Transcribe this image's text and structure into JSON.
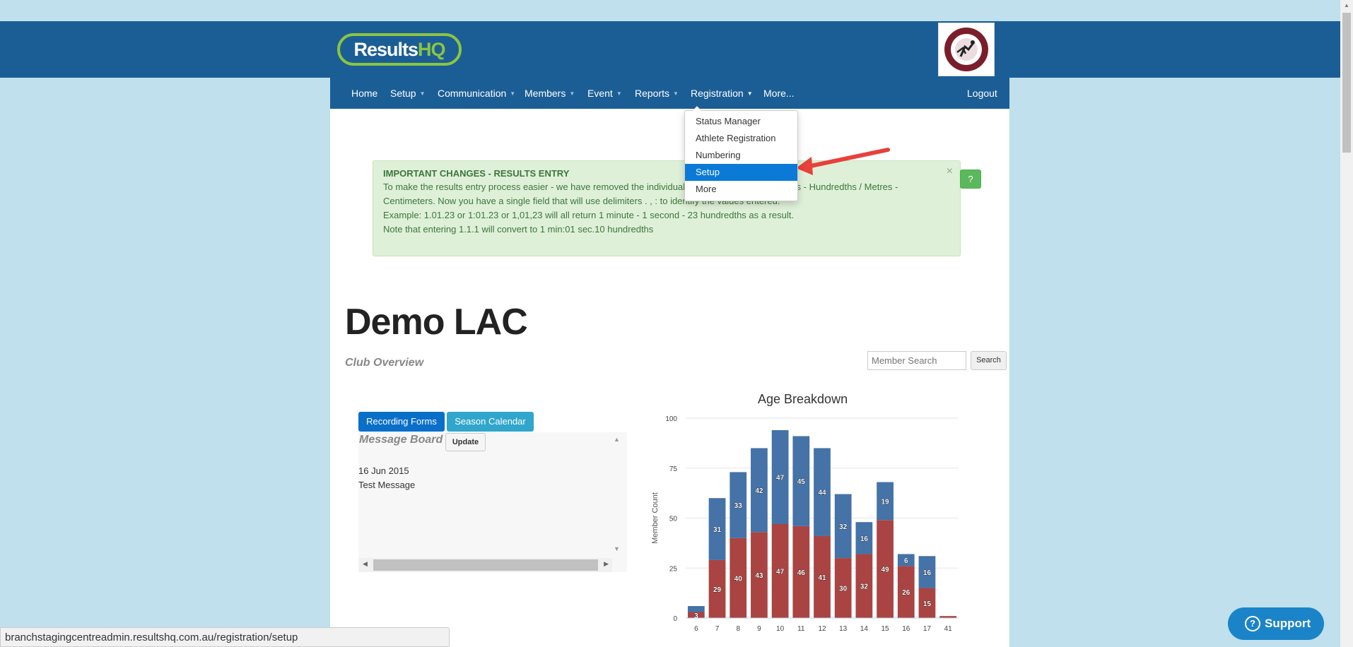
{
  "brand": {
    "logo_text_a": "Results",
    "logo_text_b": "HQ",
    "club_badge_icon": "club-badge-icon"
  },
  "nav": {
    "items": [
      {
        "label": "Home",
        "caret": false
      },
      {
        "label": "Setup",
        "caret": true
      },
      {
        "label": "Communication",
        "caret": true
      },
      {
        "label": "Members",
        "caret": true
      },
      {
        "label": "Event",
        "caret": true
      },
      {
        "label": "Reports",
        "caret": true
      },
      {
        "label": "Registration",
        "caret": true
      },
      {
        "label": "More...",
        "caret": false
      }
    ],
    "logout": "Logout"
  },
  "dropdown": {
    "items": [
      {
        "label": "Status Manager",
        "active": false
      },
      {
        "label": "Athlete Registration",
        "active": false
      },
      {
        "label": "Numbering",
        "active": false
      },
      {
        "label": "Setup",
        "active": true
      },
      {
        "label": "More",
        "active": false
      }
    ]
  },
  "alert": {
    "title": "IMPORTANT CHANGES - RESULTS ENTRY",
    "line1": "To make the results entry process easier - we have removed the individual fields for Minutes - Seconds - Hundredths / Metres -",
    "line2": "Centimeters. Now you have a single field that will use delimiters . , : to identify the values entered.",
    "line3": "Example: 1.01.23 or 1:01.23 or 1,01,23 will all return 1 minute - 1 second - 23 hundredths as a result.",
    "line4": "Note that entering 1.1.1 will convert to 1 min:01 sec.10 hundredths",
    "close": "×",
    "help": "?"
  },
  "page": {
    "title": "Demo LAC",
    "subtitle": "Club Overview"
  },
  "search": {
    "placeholder": "Member Search",
    "button": "Search"
  },
  "buttons": {
    "recording_forms": "Recording Forms",
    "season_calendar": "Season Calendar"
  },
  "message_board": {
    "title": "Message Board",
    "update": "Update",
    "date": "16 Jun 2015",
    "message": "Test Message"
  },
  "chart_data": {
    "type": "bar",
    "stacked": true,
    "title": "Age Breakdown",
    "ylabel": "Member Count",
    "xlabel": "",
    "ylim": [
      0,
      100
    ],
    "yticks": [
      0,
      25,
      50,
      75,
      100
    ],
    "categories": [
      "6",
      "7",
      "8",
      "9",
      "10",
      "11",
      "12",
      "13",
      "14",
      "15",
      "16",
      "17",
      "41"
    ],
    "series": [
      {
        "values": [
          3,
          29,
          40,
          43,
          47,
          46,
          41,
          30,
          32,
          49,
          26,
          15,
          1
        ],
        "color": "#a94442"
      },
      {
        "values": [
          3,
          31,
          33,
          42,
          47,
          45,
          44,
          32,
          16,
          19,
          6,
          16,
          0
        ],
        "color": "#4572a7"
      }
    ],
    "labels_bottom": [
      "3",
      "29",
      "40",
      "43",
      "47",
      "46",
      "41",
      "30",
      "32",
      "49",
      "26",
      "15",
      ""
    ],
    "labels_top": [
      "",
      "31",
      "33",
      "42",
      "47",
      "45",
      "44",
      "32",
      "16",
      "19",
      "6",
      "16",
      ""
    ],
    "grid": true
  },
  "status_bar": {
    "url": "branchstagingcentreadmin.resultshq.com.au/registration/setup"
  },
  "support": {
    "label": "Support",
    "icon": "question-icon"
  },
  "colors": {
    "nav": "#1b5e96",
    "accent_green": "#8bc53f",
    "active_item": "#0a7ad6",
    "alert_bg": "#dff0d8"
  }
}
